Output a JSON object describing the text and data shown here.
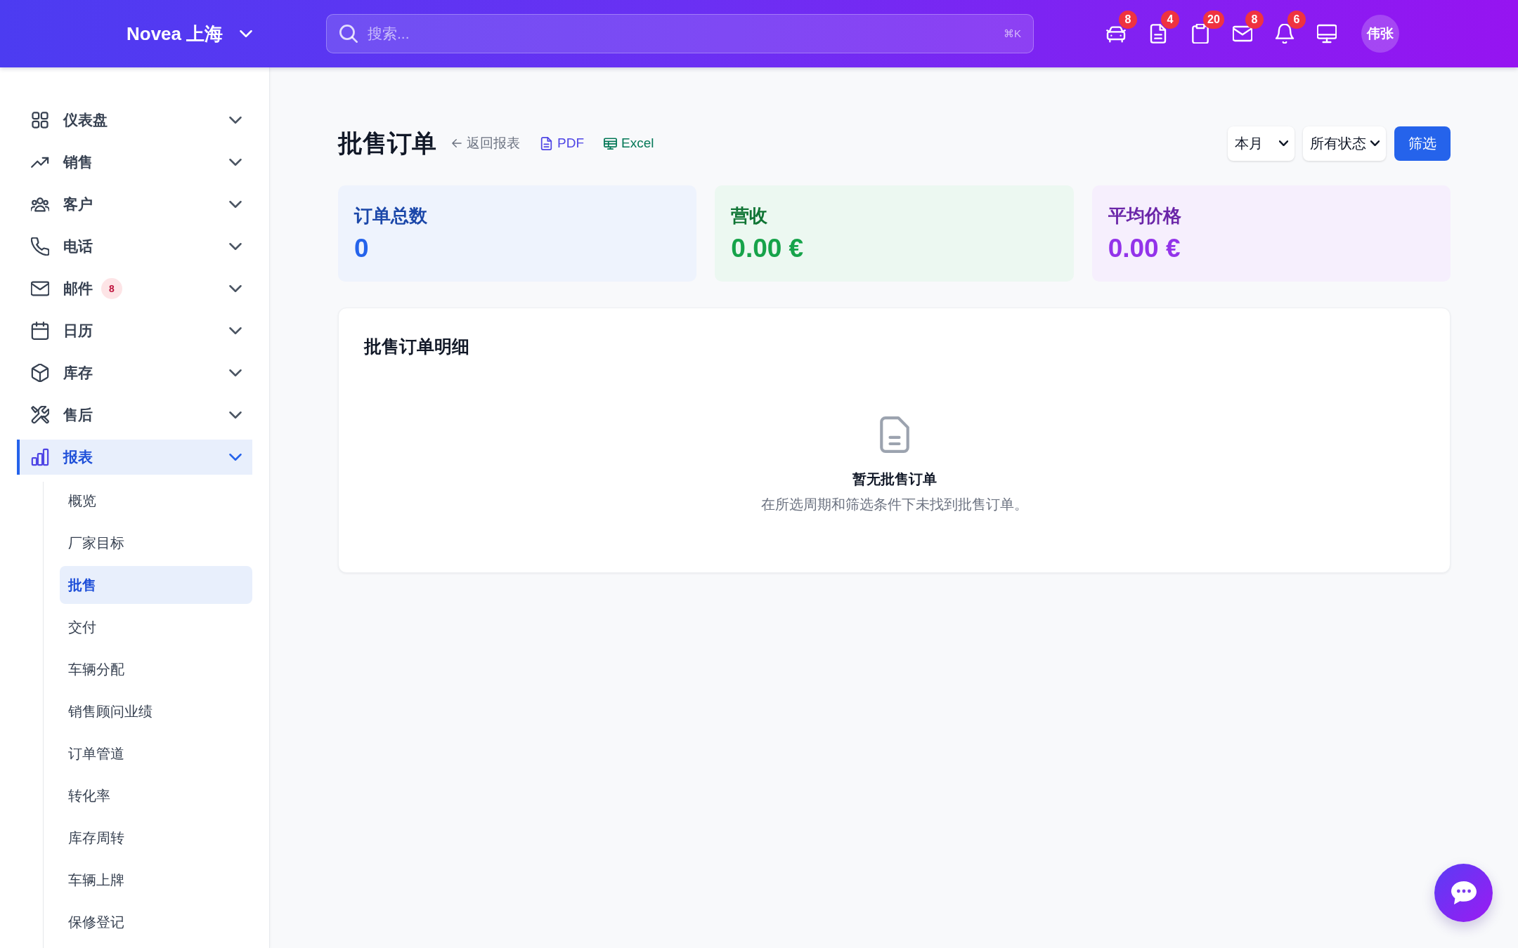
{
  "header": {
    "brand": "Novea 上海",
    "search": {
      "placeholder": "搜索...",
      "shortcut": "⌘K"
    },
    "actions": [
      {
        "kind": "vehicles",
        "badge": "8"
      },
      {
        "kind": "documents",
        "badge": "4"
      },
      {
        "kind": "tasks",
        "badge": "20"
      },
      {
        "kind": "mail",
        "badge": "8"
      },
      {
        "kind": "notifications",
        "badge": "6"
      },
      {
        "kind": "display"
      }
    ],
    "avatar": "伟张"
  },
  "sidebar": {
    "items": [
      {
        "label": "仪表盘",
        "selected": false
      },
      {
        "label": "销售",
        "selected": false
      },
      {
        "label": "客户",
        "selected": false
      },
      {
        "label": "电话",
        "selected": false
      },
      {
        "label": "邮件",
        "selected": false,
        "badge": "8"
      },
      {
        "label": "日历",
        "selected": false
      },
      {
        "label": "库存",
        "selected": false
      },
      {
        "label": "售后",
        "selected": false
      },
      {
        "label": "报表",
        "selected": true,
        "children": [
          {
            "label": "概览",
            "selected": false
          },
          {
            "label": "厂家目标",
            "selected": false
          },
          {
            "label": "批售",
            "selected": true
          },
          {
            "label": "交付",
            "selected": false
          },
          {
            "label": "车辆分配",
            "selected": false
          },
          {
            "label": "销售顾问业绩",
            "selected": false
          },
          {
            "label": "订单管道",
            "selected": false
          },
          {
            "label": "转化率",
            "selected": false
          },
          {
            "label": "库存周转",
            "selected": false
          },
          {
            "label": "车辆上牌",
            "selected": false
          },
          {
            "label": "保修登记",
            "selected": false
          }
        ]
      }
    ]
  },
  "page": {
    "title": "批售订单",
    "links": [
      {
        "kind": "back",
        "label": "返回报表"
      },
      {
        "kind": "pdf",
        "label": "PDF"
      },
      {
        "kind": "excel",
        "label": "Excel"
      }
    ],
    "filters": [
      {
        "value": "本月"
      },
      {
        "value": "所有状态"
      }
    ],
    "filter_button": "筛选",
    "stats": [
      {
        "label": "订单总数",
        "value": "0",
        "color": "#2563eb"
      },
      {
        "label": "营收",
        "value": "0.00 €",
        "color": "#16a34a"
      },
      {
        "label": "平均价格",
        "value": "0.00 €",
        "color": "#9333ea"
      }
    ],
    "detail": {
      "title": "批售订单明细",
      "empty_title": "暂无批售订单",
      "empty_text": "在所选周期和筛选条件下未找到批售订单。"
    }
  }
}
